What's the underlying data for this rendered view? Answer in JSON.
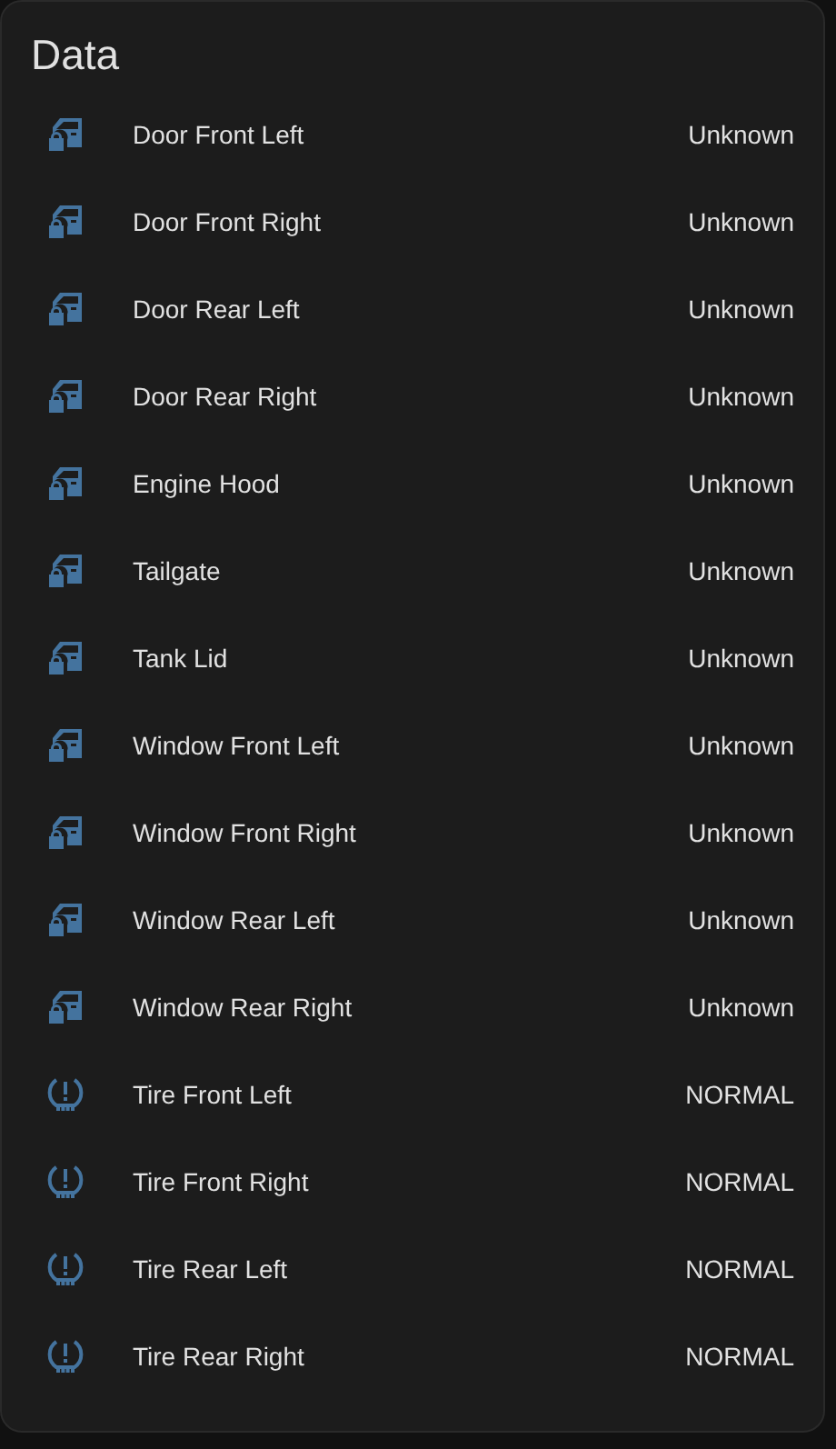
{
  "card": {
    "title": "Data",
    "rows": [
      {
        "kind": "door",
        "name": "Door Front Left",
        "state": "Unknown"
      },
      {
        "kind": "door",
        "name": "Door Front Right",
        "state": "Unknown"
      },
      {
        "kind": "door",
        "name": "Door Rear Left",
        "state": "Unknown"
      },
      {
        "kind": "door",
        "name": "Door Rear Right",
        "state": "Unknown"
      },
      {
        "kind": "door",
        "name": "Engine Hood",
        "state": "Unknown"
      },
      {
        "kind": "door",
        "name": "Tailgate",
        "state": "Unknown"
      },
      {
        "kind": "door",
        "name": "Tank Lid",
        "state": "Unknown"
      },
      {
        "kind": "door",
        "name": "Window Front Left",
        "state": "Unknown"
      },
      {
        "kind": "door",
        "name": "Window Front Right",
        "state": "Unknown"
      },
      {
        "kind": "door",
        "name": "Window Rear Left",
        "state": "Unknown"
      },
      {
        "kind": "door",
        "name": "Window Rear Right",
        "state": "Unknown"
      },
      {
        "kind": "tire",
        "name": "Tire Front Left",
        "state": "NORMAL"
      },
      {
        "kind": "tire",
        "name": "Tire Front Right",
        "state": "NORMAL"
      },
      {
        "kind": "tire",
        "name": "Tire Rear Left",
        "state": "NORMAL"
      },
      {
        "kind": "tire",
        "name": "Tire Rear Right",
        "state": "NORMAL"
      }
    ]
  }
}
